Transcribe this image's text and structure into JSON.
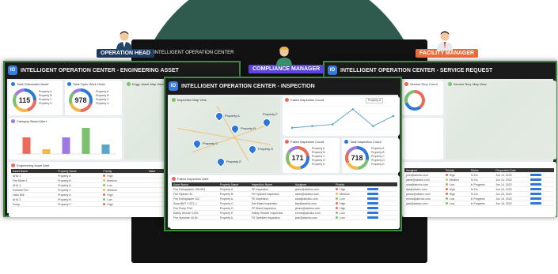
{
  "roles": {
    "operation_head": "OPERATION HEAD",
    "operation_center": "INTELLIGENT OPERATION CENTER",
    "compliance_manager": "COMPLIANCE MANAGER",
    "facility_manager": "FACILITY MANAGER"
  },
  "colors": {
    "brand_green": "#2f5b4f",
    "operation_head_tag": "#1e3a5f",
    "compliance_tag": "#5b45e0",
    "facility_tag": "#ea6a3a",
    "accent_blue": "#2f77d6"
  },
  "left_screen": {
    "title": "INTELLIGENT OPERATION CENTER - ENGINEERING ASSET",
    "kpi1": {
      "label": "Total Onboarded Asset",
      "value": "115"
    },
    "kpi2": {
      "label": "Total Open Work Order",
      "value": "978"
    },
    "map_label": "Engg. Asset Map View",
    "bar_chart_label": "Category Based Alert",
    "table_label": "Engineering Asset Alert",
    "table_headers": [
      "Asset Name",
      "Property Name",
      "Priority",
      "Value",
      "Unit"
    ],
    "table_rows": [
      [
        "AHU 1",
        "Property A",
        "High",
        "",
        ""
      ],
      [
        "Fire Meter 1",
        "Property B",
        "Medium",
        "",
        ""
      ],
      [
        "AHU 4",
        "Property A",
        "Low",
        "",
        ""
      ],
      [
        "Exhaust Fan",
        "Property C",
        "Medium",
        "",
        ""
      ],
      [
        "Hallo 80k",
        "Property A",
        "High",
        "",
        ""
      ],
      [
        "AHU 2",
        "Property B",
        "Low",
        "",
        ""
      ],
      [
        "Pump",
        "Property C",
        "High",
        "",
        ""
      ]
    ]
  },
  "center_screen": {
    "title": "INTELLIGENT OPERATION CENTER - INSPECTION",
    "map_label": "Inspection Map View",
    "line_chart_label": "Failed Inspection Count",
    "donut1": {
      "label": "Failed Inspection Count",
      "value": "171"
    },
    "donut2": {
      "label": "Total Inspection Count",
      "value": "718"
    },
    "legend": [
      "Property A",
      "Property B",
      "Property C",
      "Property D",
      "Property E"
    ],
    "map_pins": [
      "Property A",
      "Property B",
      "Property C",
      "Property D",
      "Property E",
      "Property F"
    ],
    "table_label": "Failed Inspection Alert",
    "table_headers": [
      "Asset Name",
      "Property Name",
      "Inspection Name",
      "Assignee",
      "Priority",
      ""
    ],
    "table_rows": [
      [
        "Fire Extinguisher 198-983",
        "Property A",
        "FE Inspection",
        "jaime@abclinc.com",
        "High"
      ],
      [
        "Fire Hydrant 34",
        "Property B",
        "FH Hydrant Inspection",
        "alexa@abclinc.com",
        "Medium"
      ],
      [
        "Fire Extinguisher 102",
        "Property A",
        "FE Inspection",
        "sara@abclinc.com",
        "Low"
      ],
      [
        "Swar BMT Y-ST1-1",
        "Property C",
        "Swr Maint Inspection",
        "lisa@abclinc.com",
        "High"
      ],
      [
        "Fire Pump PNV",
        "Property D",
        "FP Maint Inspection",
        "james@abclinc.com",
        "High"
      ],
      [
        "Safety Shower 1434",
        "Property E",
        "Safety Shower Inspection",
        "emma@abclinc.com",
        "Low"
      ],
      [
        "Fire Sprinkler 18-90",
        "Property A",
        "FS Sprinkler Inspection",
        "jack@abclinc.com",
        "Low"
      ]
    ]
  },
  "right_screen": {
    "title": "INTELLIGENT OPERATION CENTER - SERVICE REQUEST",
    "chart_label": "Service Req. Count",
    "map_label": "Service Req. Map View",
    "table_headers": [
      "Assignee",
      "Priority",
      "Status",
      "Requested Date",
      ""
    ],
    "table_rows": [
      [
        "john@abcinc.com",
        "High",
        "To Do",
        "Jun 13, 2023"
      ],
      [
        "jaime@abcinc.com",
        "Medium",
        "To Do",
        "Jun 14, 2023"
      ],
      [
        "sara@abcinc.com",
        "Low",
        "In Progress",
        "Jun 14, 2023"
      ],
      [
        "lisa@abcinc.com",
        "High",
        "To Do",
        "Jun 15, 2023"
      ],
      [
        "james@abcinc.com",
        "High",
        "To Do",
        "Jun 15, 2023"
      ],
      [
        "emma@abcinc.com",
        "Low",
        "In Progress",
        "Jun 16, 2023"
      ],
      [
        "jack@abcinc.com",
        "Low",
        "In Progress",
        "Jun 16, 2023"
      ]
    ]
  },
  "chart_data": [
    {
      "type": "line",
      "title": "Failed Inspection Count",
      "x": [
        "Property A",
        "Property B",
        "Property C",
        "Property D",
        "Property E",
        "Property F"
      ],
      "series": [
        {
          "name": "Property A",
          "values": [
            1,
            2,
            3,
            12,
            2,
            8
          ]
        }
      ],
      "ylim": [
        0,
        14
      ]
    },
    {
      "type": "bar",
      "title": "Category Based Alert",
      "categories": [
        "Property A",
        "Property B",
        "Property C",
        "Property D",
        "Property E"
      ],
      "values": [
        7,
        2,
        7,
        11,
        4
      ],
      "ylim": [
        0,
        12
      ]
    }
  ]
}
